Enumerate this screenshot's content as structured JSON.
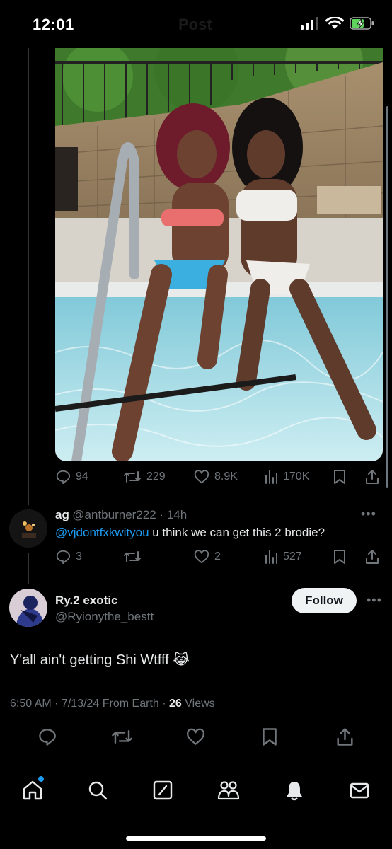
{
  "status_bar": {
    "time": "12:01",
    "ghost_title": "Post"
  },
  "parent_post": {
    "image_alt": "two women sitting at the edge of a pool",
    "stats": {
      "replies": "94",
      "reposts": "229",
      "likes": "8.9K",
      "views": "170K"
    }
  },
  "reply": {
    "display_name": "ag",
    "handle": "@antburner222",
    "time": "14h",
    "mention": "@vjdontfxkwityou",
    "text": " u think we can get this 2 brodie?",
    "stats": {
      "replies": "3",
      "reposts": "",
      "likes": "2",
      "views": "527"
    }
  },
  "main_post": {
    "display_name": "Ry.2 exotic",
    "handle": "@Ryionythe_bestt",
    "follow_label": "Follow",
    "text": "Y'all ain't getting Shi Wtfff 😹",
    "time": "6:50 AM",
    "date": "7/13/24",
    "source": "From Earth",
    "views_count": "26",
    "views_label": "Views"
  },
  "icons": {
    "reply": "reply-icon",
    "repost": "repost-icon",
    "like": "heart-icon",
    "views": "views-icon",
    "bookmark": "bookmark-icon",
    "share": "share-icon",
    "home": "home-icon",
    "search": "search-icon",
    "grok": "grok-icon",
    "communities": "communities-icon",
    "notifications": "bell-icon",
    "messages": "mail-icon"
  },
  "colors": {
    "accent": "#1d9bf0",
    "muted": "#71767b",
    "text": "#e7e9ea",
    "background": "#000000"
  }
}
